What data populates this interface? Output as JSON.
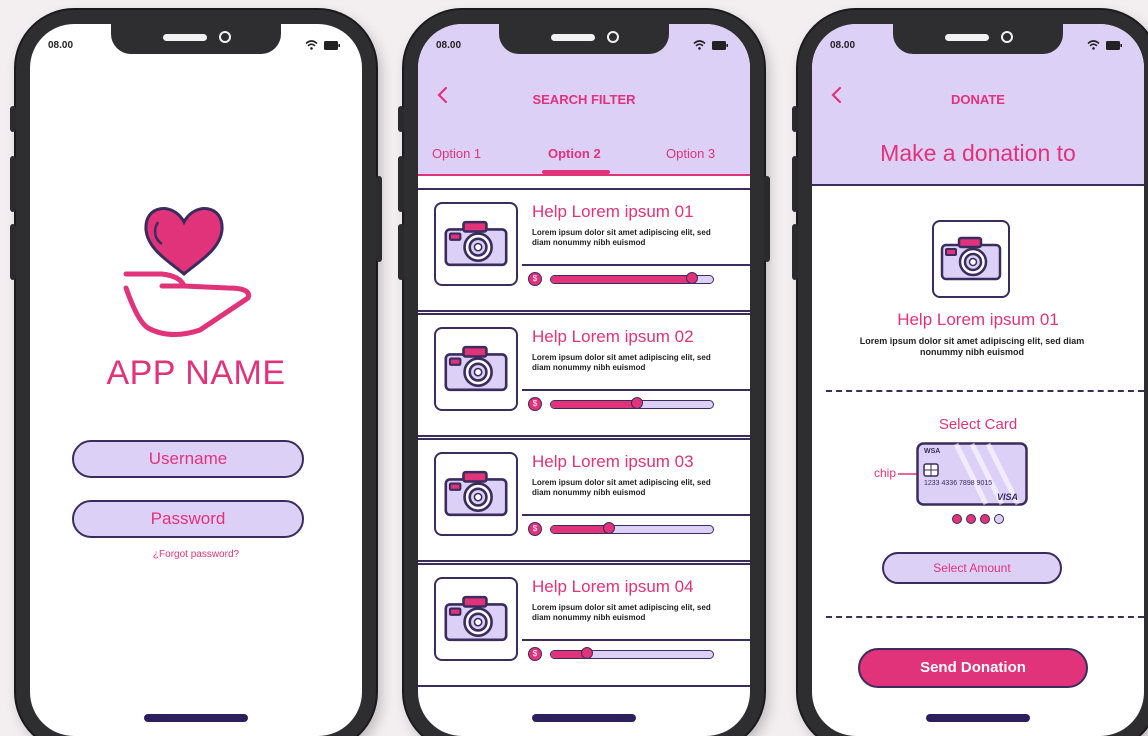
{
  "status_time": "08.00",
  "colors": {
    "accent": "#e0337a",
    "lilac": "#ddd0f6",
    "outline": "#3b2c5e",
    "frame": "#2e2e31"
  },
  "login": {
    "app_name": "APP NAME",
    "username_placeholder": "Username",
    "password_placeholder": "Password",
    "forgot_password": "¿Forgot password?"
  },
  "search_filter": {
    "title": "SEARCH FILTER",
    "tabs": [
      {
        "label": "Option 1",
        "active": false
      },
      {
        "label": "Option 2",
        "active": true
      },
      {
        "label": "Option 3",
        "active": false
      }
    ],
    "items": [
      {
        "title": "Help Lorem ipsum 01",
        "description": "Lorem ipsum dolor sit amet adipiscing elit, sed diam nonummy nibh euismod",
        "progress": 0.87,
        "icon": "camera-icon"
      },
      {
        "title": "Help Lorem ipsum 02",
        "description": "Lorem ipsum dolor sit amet adipiscing elit, sed diam nonummy nibh euismod",
        "progress": 0.53,
        "icon": "camera-icon"
      },
      {
        "title": "Help Lorem ipsum 03",
        "description": "Lorem ipsum dolor sit amet adipiscing elit, sed diam nonummy nibh euismod",
        "progress": 0.36,
        "icon": "camera-icon"
      },
      {
        "title": "Help Lorem ipsum 04",
        "description": "Lorem ipsum dolor sit amet adipiscing elit, sed diam nonummy nibh euismod",
        "progress": 0.22,
        "icon": "camera-icon"
      }
    ]
  },
  "donate": {
    "title": "DONATE",
    "heading": "Make a donation to",
    "item_title": "Help Lorem ipsum 01",
    "item_description": "Lorem ipsum dolor sit amet adipiscing elit, sed diam nonummy nibh euismod",
    "select_card": "Select Card",
    "chip_label": "chip",
    "card": {
      "brand_top": "WSA",
      "number": "1233  4336  7898  9015",
      "brand": "VISA"
    },
    "card_dots_active": 3,
    "select_amount": "Select Amount",
    "send_button": "Send Donation"
  }
}
